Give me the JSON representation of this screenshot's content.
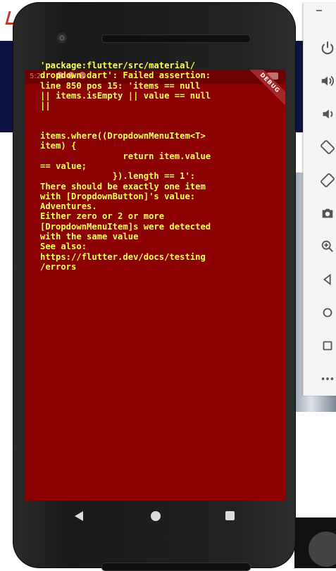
{
  "emulator": {
    "error_message": "'package:flutter/src/material/\ndropdown.dart': Failed assertion:\nline 850 pos 15: 'items == null\n|| items.isEmpty || value == null\n||\n\n\nitems.where((DropdownMenuItem<T>\nitem) {\n                return item.value\n== value;\n              }).length == 1':\nThere should be exactly one item\nwith [DropdownButton]'s value:\nAdventures.\nEither zero or 2 or more\n[DropdownMenuItem]s were detected\nwith the same value\nSee also:\nhttps://flutter.dev/docs/testing\n/errors",
    "debug_banner": "DEBUG",
    "status_time": "5:27"
  },
  "colors": {
    "error_bg": "#8b0000",
    "error_text": "#ffff55",
    "phone_body": "#1e1e1e"
  },
  "side_toolbar": {
    "items": [
      "minimize-icon",
      "power-icon",
      "volume-up-icon",
      "volume-down-icon",
      "rotate-left-icon",
      "rotate-right-icon",
      "camera-icon",
      "zoom-icon",
      "back-icon",
      "home-icon",
      "overview-icon",
      "more-icon"
    ]
  }
}
